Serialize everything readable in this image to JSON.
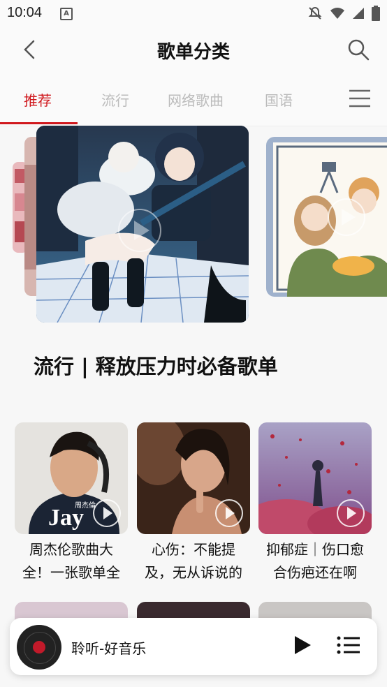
{
  "status_bar": {
    "time": "10:04",
    "a_label": "A"
  },
  "header": {
    "title": "歌单分类"
  },
  "tabs": [
    {
      "label": "推荐",
      "active": true
    },
    {
      "label": "流行"
    },
    {
      "label": "网络歌曲"
    },
    {
      "label": "国语"
    }
  ],
  "featured": {
    "title": "流行 | 释放压力时必备歌单"
  },
  "playlists": [
    {
      "title_line1": "周杰伦歌曲大",
      "title_line2": "全！一张歌单全",
      "cover_text": "Jay",
      "cover_subtext": "周杰倫"
    },
    {
      "title_line1": "心伤：不能提",
      "title_line2": "及，无从诉说的"
    },
    {
      "title_line1": "抑郁症｜伤口愈",
      "title_line2": "合伤疤还在啊"
    }
  ],
  "player": {
    "track": "聆听-好音乐"
  },
  "colors": {
    "accent": "#d0181d",
    "inactive_tab": "#bbbbbb"
  }
}
